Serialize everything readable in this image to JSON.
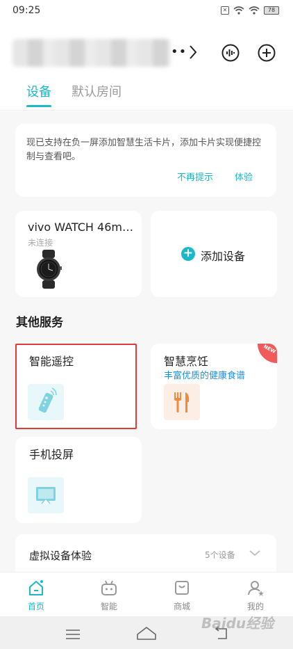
{
  "status_bar": {
    "time": "09:25",
    "battery": "78"
  },
  "header": {
    "more_dots": "••"
  },
  "tabs": [
    {
      "label": "设备",
      "active": true
    },
    {
      "label": "默认房间",
      "active": false
    }
  ],
  "tip_card": {
    "text": "现已支持在负一屏添加智慧生活卡片，添加卡片实现便捷控制与查看吧。",
    "dismiss_label": "不再提示",
    "try_label": "体验"
  },
  "devices": [
    {
      "name": "vivo WATCH 46m…",
      "status": "未连接"
    }
  ],
  "add_device": {
    "label": "添加设备"
  },
  "other_services": {
    "title": "其他服务",
    "items": [
      {
        "title": "智能遥控"
      },
      {
        "title": "智慧烹饪",
        "subtitle": "丰富优质的健康食谱",
        "badge": "NEW"
      },
      {
        "title": "手机投屏"
      }
    ]
  },
  "virtual_devices": {
    "title": "虚拟设备体验",
    "count": "5个设备"
  },
  "bottom_nav": [
    {
      "label": "首页",
      "icon": "home-icon",
      "active": true
    },
    {
      "label": "智能",
      "icon": "robot-icon",
      "active": false
    },
    {
      "label": "商城",
      "icon": "shop-icon",
      "active": false
    },
    {
      "label": "我的",
      "icon": "user-icon",
      "active": false
    }
  ],
  "watermark": "Baidu经验",
  "colors": {
    "accent": "#1ab8c8",
    "link_blue": "#1a8fde",
    "highlight_red": "#e03a3a",
    "badge_red": "#f05a5a"
  }
}
